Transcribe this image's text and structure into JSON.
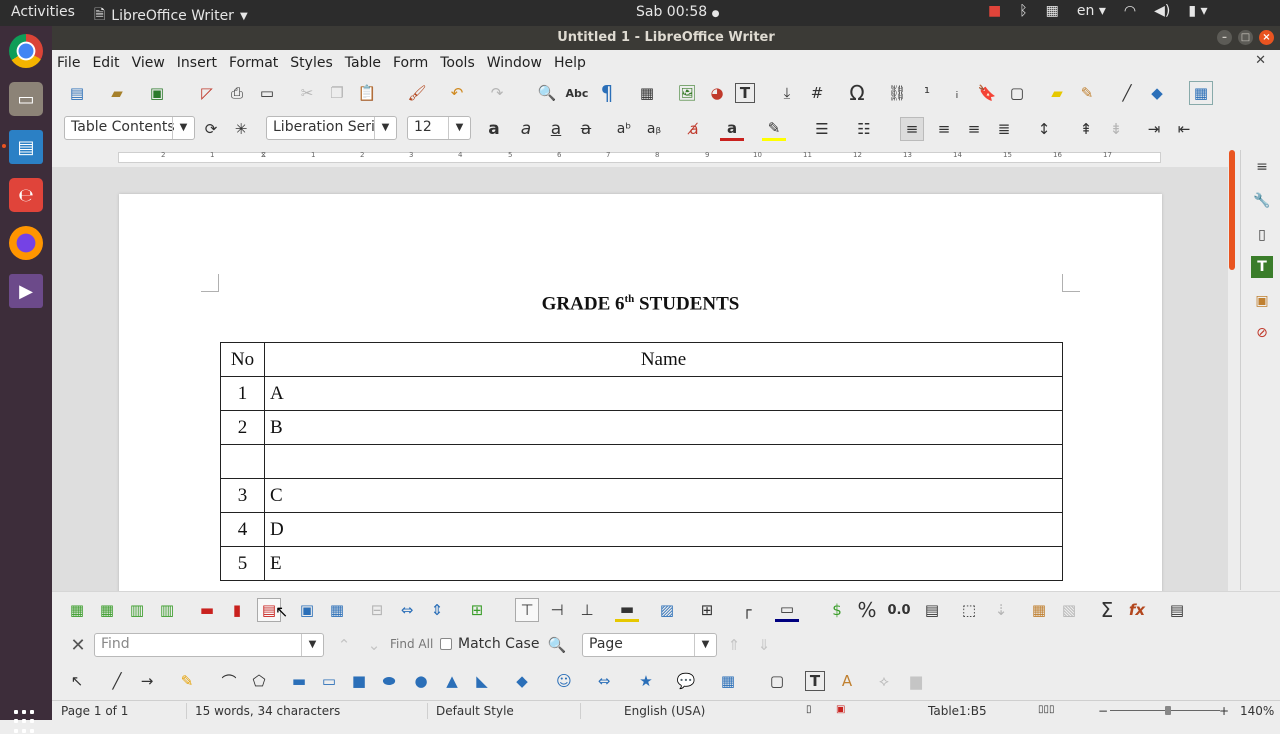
{
  "topbar": {
    "activities": "Activities",
    "app_name": "LibreOffice Writer",
    "clock": "Sab 00:58",
    "lang": "en"
  },
  "window": {
    "title": "Untitled 1 - LibreOffice Writer"
  },
  "menu": [
    "File",
    "Edit",
    "View",
    "Insert",
    "Format",
    "Styles",
    "Table",
    "Form",
    "Tools",
    "Window",
    "Help"
  ],
  "formatting": {
    "paragraph_style": "Table Contents",
    "font_name": "Liberation Seri",
    "font_size": "12"
  },
  "ruler_numbers": [
    "2",
    "1",
    "1",
    "2",
    "3",
    "4",
    "5",
    "6",
    "7",
    "8",
    "9",
    "10",
    "11",
    "12",
    "13",
    "14",
    "15",
    "16",
    "17"
  ],
  "document": {
    "heading_pre": "GRADE 6",
    "heading_sup": "th",
    "heading_post": " STUDENTS",
    "table": {
      "header": {
        "no": "No",
        "name": "Name"
      },
      "rows": [
        {
          "no": "1",
          "name": "A"
        },
        {
          "no": "2",
          "name": "B"
        },
        {
          "no": "",
          "name": ""
        },
        {
          "no": "3",
          "name": "C"
        },
        {
          "no": "4",
          "name": "D"
        },
        {
          "no": "5",
          "name": "E"
        }
      ]
    }
  },
  "table_toolbar": {
    "percent": "%",
    "decimal": "0.0",
    "sum": "Σ",
    "fx": "fx"
  },
  "findbar": {
    "placeholder": "Find",
    "find_all": "Find All",
    "match_case": "Match Case",
    "search_scope": "Page"
  },
  "status": {
    "page": "Page 1 of 1",
    "words": "15 words, 34 characters",
    "page_style": "Default Style",
    "language": "English (USA)",
    "cell": "Table1:B5",
    "zoom": "140%"
  },
  "colors": {
    "accent": "#e95420",
    "dock": "#3d2d3a",
    "topbar": "#2c2c2c"
  }
}
